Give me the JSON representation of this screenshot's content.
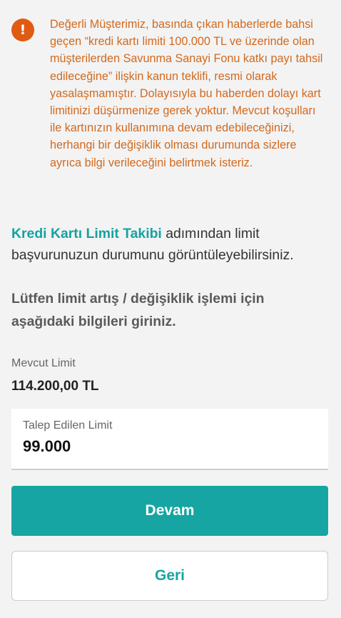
{
  "colors": {
    "background": "#f3f3f3",
    "warning": "#d2691e",
    "warning_icon": "#e05a12",
    "accent": "#16a5a2",
    "text": "#333333"
  },
  "notice": {
    "icon": "exclamation-icon",
    "icon_glyph": "!",
    "text": "Değerli Müşterimiz, basında çıkan haberlerde bahsi geçen “kredi kartı limiti 100.000 TL ve üzerinde olan müşterilerden Savunma Sanayi Fonu katkı payı tahsil edileceğine” ilişkin kanun teklifi, resmi olarak yasalaşmamıştır. Dolayısıyla bu haberden dolayı kart limitinizi düşürmenize gerek yoktur. Mevcut koşulları ile kartınızın kullanımına devam edebileceğinizi, herhangi bir değişiklik olması durumunda sizlere ayrıca bilgi verileceğini belirtmek isteriz."
  },
  "intro": {
    "link_text": "Kredi Kartı Limit Takibi",
    "rest_text": " adımından limit başvurunuzun durumunu görüntüleyebilirsiniz."
  },
  "instructions": "Lütfen limit artış / değişiklik işlemi için aşağıdaki bilgileri giriniz.",
  "current_limit": {
    "label": "Mevcut Limit",
    "value": "114.200,00 TL"
  },
  "requested_limit": {
    "label": "Talep Edilen Limit",
    "value": "99.000"
  },
  "buttons": {
    "continue": "Devam",
    "back": "Geri"
  }
}
